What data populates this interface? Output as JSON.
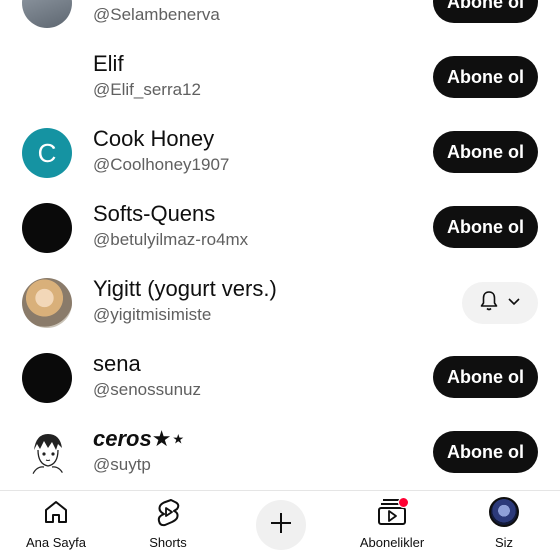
{
  "subscriptions": [
    {
      "name": "",
      "handle": "@Selambenerva",
      "button": "Abone ol",
      "avatar": "grey"
    },
    {
      "name": "Elif",
      "handle": "@Elif_serra12",
      "button": "Abone ol",
      "avatar": "none"
    },
    {
      "name": "Cook Honey",
      "handle": "@Coolhoney1907",
      "button": "Abone ol",
      "avatar": "letter",
      "avatar_letter": "C",
      "avatar_color": "#1593a2"
    },
    {
      "name": "Softs-Quens",
      "handle": "@betulyilmaz-ro4mx",
      "button": "Abone ol",
      "avatar": "black"
    },
    {
      "name": "Yigitt (yogurt vers.)",
      "handle": "@yigitmisimiste",
      "button": "",
      "avatar": "photo",
      "subscribed": true
    },
    {
      "name": "sena",
      "handle": "@senossunuz",
      "button": "Abone ol",
      "avatar": "black"
    },
    {
      "name": "ceros★⋆",
      "handle": "@suytp",
      "button": "Abone ol",
      "avatar": "drawing"
    }
  ],
  "nav": {
    "home_label": "Ana Sayfa",
    "shorts_label": "Shorts",
    "subscriptions_label": "Abonelikler",
    "you_label": "Siz"
  },
  "colors": {
    "accent": "#0f0f0f",
    "notification": "#ff0033",
    "handle_text": "#606060"
  },
  "icons": [
    "home-icon",
    "shorts-icon",
    "plus-icon",
    "subscriptions-icon",
    "bell-icon",
    "chevron-down-icon"
  ]
}
